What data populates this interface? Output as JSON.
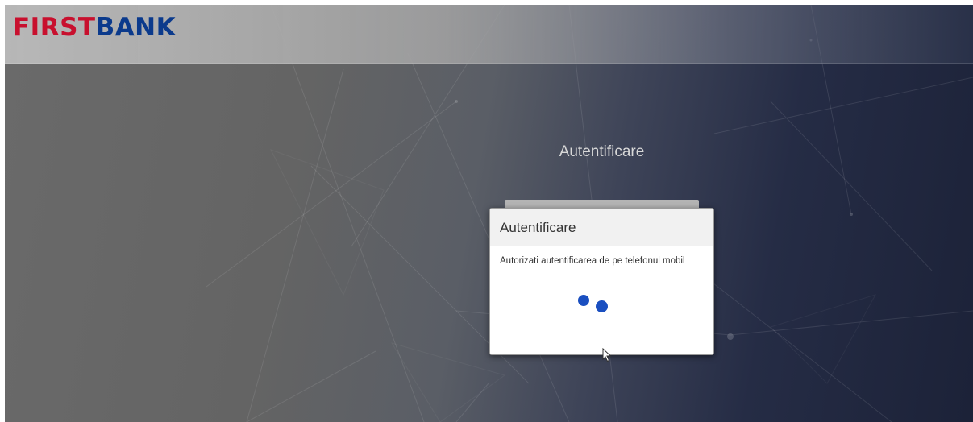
{
  "header": {
    "logo_part1": "FIRST",
    "logo_part2": "BANK"
  },
  "login": {
    "heading": "Autentificare"
  },
  "modal": {
    "title": "Autentificare",
    "message": "Autorizati autentificarea de pe telefonul mobil",
    "spinner": "loading-spinner"
  },
  "colors": {
    "logo_red": "#c8102e",
    "logo_blue": "#0b3a8c",
    "spinner_blue": "#1a4fc0"
  }
}
